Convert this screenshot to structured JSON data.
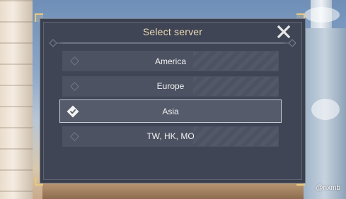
{
  "dialog": {
    "title": "Select server",
    "close_icon": "close-icon"
  },
  "servers": [
    {
      "label": "America",
      "selected": false
    },
    {
      "label": "Europe",
      "selected": false
    },
    {
      "label": "Asia",
      "selected": true
    },
    {
      "label": "TW, HK, MO",
      "selected": false
    }
  ],
  "watermark": "@nxmb",
  "colors": {
    "panel": "#3f4554",
    "item": "#4c5262",
    "title_text": "#e9d8b4",
    "accent_gold": "#e8c97f",
    "selected_border": "#c9cdd4"
  }
}
